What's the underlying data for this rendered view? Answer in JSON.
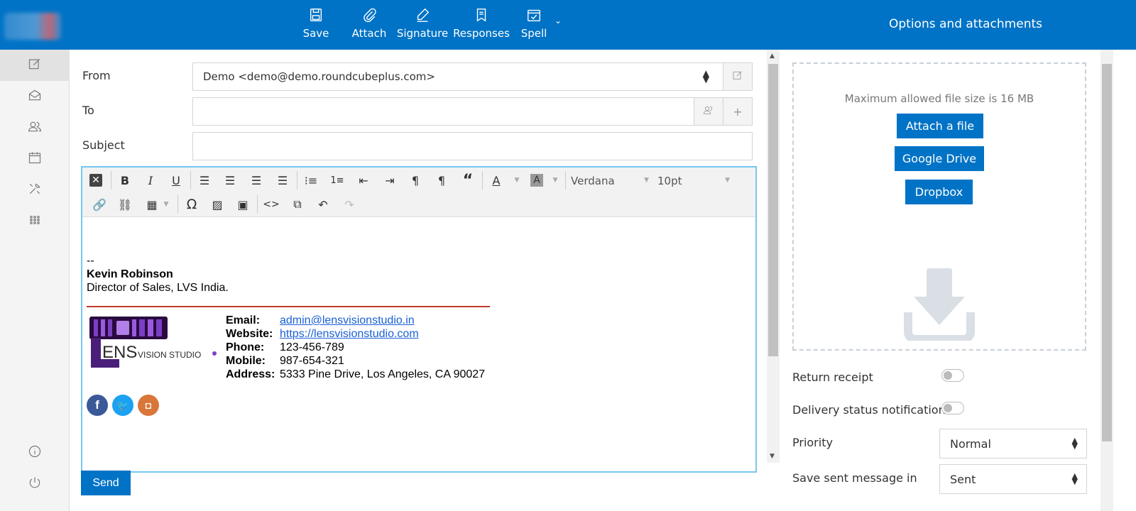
{
  "toolbar": {
    "save": "Save",
    "attach": "Attach",
    "signature": "Signature",
    "responses": "Responses",
    "spell": "Spell",
    "more": "⌄",
    "options_title": "Options and attachments"
  },
  "compose": {
    "from_label": "From",
    "from_value": "Demo <demo@demo.roundcubeplus.com>",
    "to_label": "To",
    "to_value": "",
    "subject_label": "Subject",
    "subject_value": ""
  },
  "editor": {
    "font_name": "Verdana",
    "font_size": "10pt",
    "separator": "--",
    "sig_name": "Kevin Robinson",
    "sig_title": "Director of Sales, LVS India.",
    "sig_fields": {
      "email_label": "Email:",
      "email": "admin@lensvisionstudio.in",
      "website_label": "Website:",
      "website": "https://lensvisionstudio.com",
      "phone_label": "Phone:",
      "phone": "123-456-789",
      "mobile_label": "Mobile:",
      "mobile": "987-654-321",
      "address_label": "Address:",
      "address": "5333 Pine Drive, Los Angeles, CA 90027"
    },
    "logo_text": "LENS VISION STUDIO"
  },
  "send_label": "Send",
  "attachments": {
    "max_size": "Maximum allowed file size is 16 MB",
    "attach_file": "Attach a file",
    "google_drive": "Google Drive",
    "dropbox": "Dropbox"
  },
  "options": {
    "return_receipt": "Return receipt",
    "delivery_status": "Delivery status notification",
    "priority_label": "Priority",
    "priority_value": "Normal",
    "save_sent_label": "Save sent message in",
    "save_sent_value": "Sent"
  },
  "colors": {
    "brand": "#0073c6",
    "sig_rule": "#c0392b",
    "facebook": "#3b5998",
    "twitter": "#1da1f2",
    "instagram": "#d9763a"
  }
}
